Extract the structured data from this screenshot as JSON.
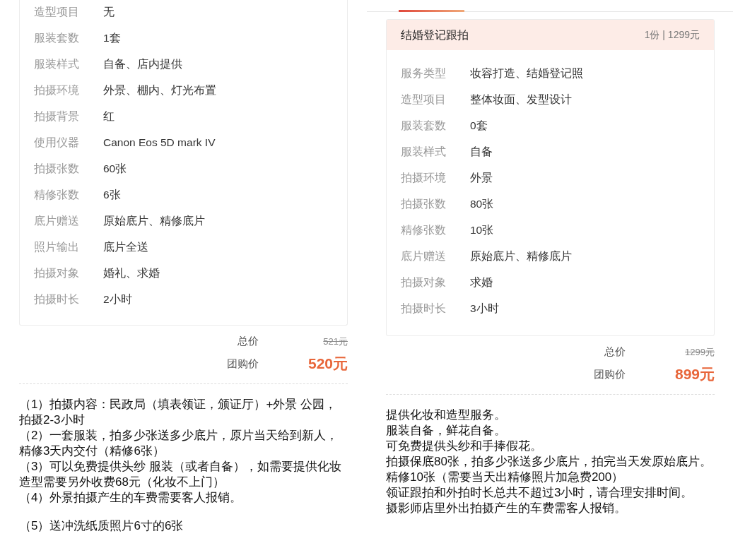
{
  "panels": [
    {
      "card": {
        "rows": [
          {
            "label": "造型项目",
            "value": "无"
          },
          {
            "label": "服装套数",
            "value": "1套"
          },
          {
            "label": "服装样式",
            "value": "自备、店内提供"
          },
          {
            "label": "拍摄环境",
            "value": "外景、棚内、灯光布置"
          },
          {
            "label": "拍摄背景",
            "value": "红"
          },
          {
            "label": "使用仪器",
            "value": "Canon Eos 5D mark IV"
          },
          {
            "label": "拍摄张数",
            "value": "60张"
          },
          {
            "label": "精修张数",
            "value": "6张"
          },
          {
            "label": "底片赠送",
            "value": "原始底片、精修底片"
          },
          {
            "label": "照片输出",
            "value": "底片全送"
          },
          {
            "label": "拍摄对象",
            "value": "婚礼、求婚"
          },
          {
            "label": "拍摄时长",
            "value": "2小时"
          }
        ]
      },
      "price": {
        "total_label": "总价",
        "total": "521元",
        "group_label": "团购价",
        "group": "520元"
      },
      "notes": [
        {
          "text": "（1）拍摄内容：民政局（填表领证，颁证厅）+外景 公园，拍摄2-3小时",
          "gap_before": false
        },
        {
          "text": "（2）一套服装，拍多少张送多少底片，原片当天给到新人，精修3天内交付（精修6张）",
          "gap_before": false
        },
        {
          "text": "（3）可以免费提供头纱 服装（或者自备），如需要提供化妆造型需要另外收费68元（化妆不上门）",
          "gap_before": false
        },
        {
          "text": "（4）外景拍摄产生的车费需要客人报销。",
          "gap_before": false
        },
        {
          "text": "（5）送冲洗纸质照片6寸的6张",
          "gap_before": true
        }
      ]
    },
    {
      "tab_underline": true,
      "card": {
        "header": {
          "title": "结婚登记跟拍",
          "meta": "1份 | 1299元"
        },
        "rows": [
          {
            "label": "服务类型",
            "value": "妆容打造、结婚登记照"
          },
          {
            "label": "造型项目",
            "value": "整体妆面、发型设计"
          },
          {
            "label": "服装套数",
            "value": "0套"
          },
          {
            "label": "服装样式",
            "value": "自备"
          },
          {
            "label": "拍摄环境",
            "value": "外景"
          },
          {
            "label": "拍摄张数",
            "value": "80张"
          },
          {
            "label": "精修张数",
            "value": "10张"
          },
          {
            "label": "底片赠送",
            "value": "原始底片、精修底片"
          },
          {
            "label": "拍摄对象",
            "value": "求婚"
          },
          {
            "label": "拍摄时长",
            "value": "3小时"
          }
        ]
      },
      "price": {
        "total_label": "总价",
        "total": "1299元",
        "group_label": "团购价",
        "group": "899元"
      },
      "notes": [
        {
          "text": "提供化妆和造型服务。",
          "gap_before": false
        },
        {
          "text": "服装自备，鲜花自备。",
          "gap_before": false
        },
        {
          "text": "可免费提供头纱和手捧假花。",
          "gap_before": false
        },
        {
          "text": "拍摄保底80张，拍多少张送多少底片，拍完当天发原始底片。",
          "gap_before": false
        },
        {
          "text": "精修10张（需要当天出精修照片加急费200）",
          "gap_before": false
        },
        {
          "text": "领证跟拍和外拍时长总共不超过3小时，请合理安排时间。",
          "gap_before": false
        },
        {
          "text": "摄影师店里外出拍摄产生的车费需客人报销。",
          "gap_before": false
        }
      ]
    }
  ]
}
